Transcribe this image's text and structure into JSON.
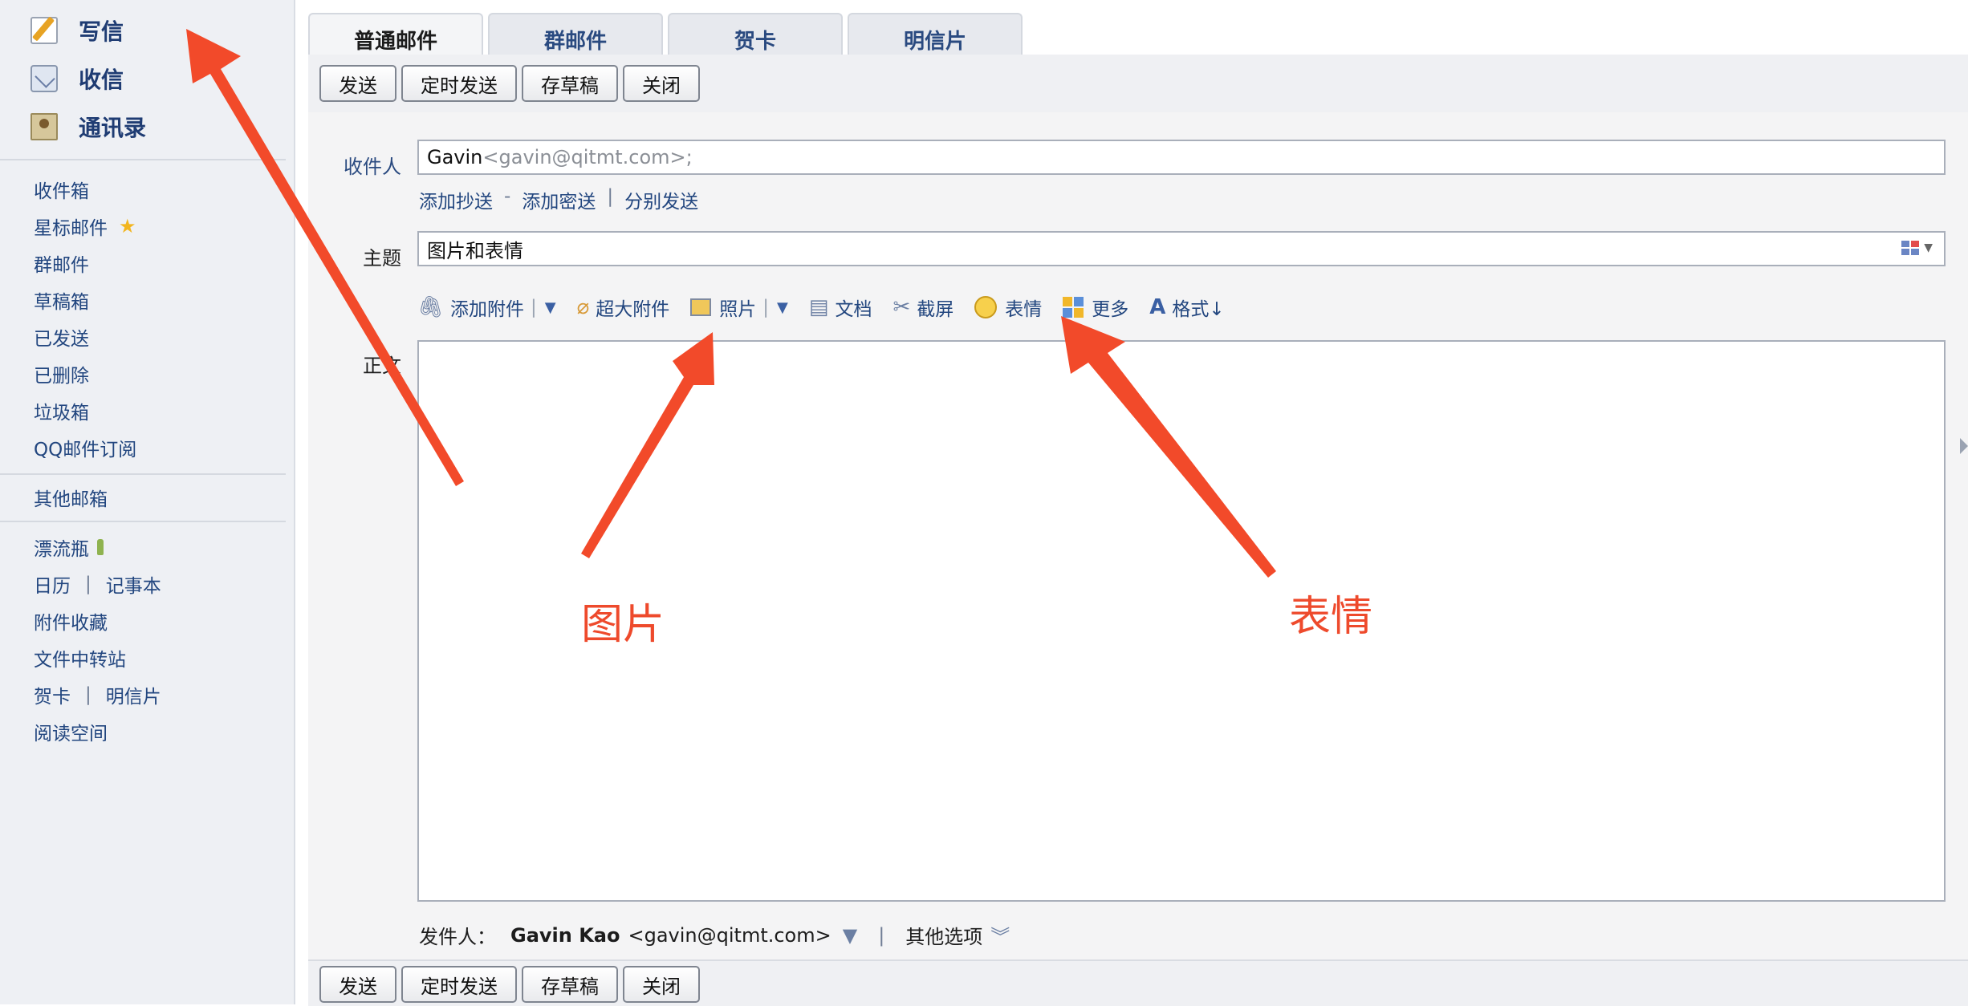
{
  "sidebar": {
    "top_items": [
      {
        "label": "写信",
        "icon": "pencil-paper-icon"
      },
      {
        "label": "收信",
        "icon": "inbox-tray-icon"
      },
      {
        "label": "通讯录",
        "icon": "contact-card-icon"
      }
    ],
    "folders": [
      "收件箱",
      "星标邮件",
      "群邮件",
      "草稿箱",
      "已发送",
      "已删除",
      "垃圾箱",
      "QQ邮件订阅"
    ],
    "other_mailbox": "其他邮箱",
    "apps": {
      "drift_bottle": "漂流瓶",
      "calendar": "日历",
      "notebook": "记事本",
      "attachments": "附件收藏",
      "file_transfer": "文件中转站",
      "greeting_card": "贺卡",
      "postcard": "明信片",
      "reading_space": "阅读空间"
    },
    "separator": "|"
  },
  "tabs": [
    "普通邮件",
    "群邮件",
    "贺卡",
    "明信片"
  ],
  "actions": {
    "send": "发送",
    "schedule": "定时发送",
    "draft": "存草稿",
    "close": "关闭"
  },
  "compose": {
    "to_label": "收件人",
    "to_name": "Gavin",
    "to_addr": "<gavin@qitmt.com>;",
    "add_cc": "添加抄送",
    "dash": "-",
    "add_bcc": "添加密送",
    "pipe": "|",
    "separate_send": "分别发送",
    "subject_label": "主题",
    "subject_value": "图片和表情",
    "body_label": "正文",
    "toolbar": {
      "attach": "添加附件",
      "big_attach": "超大附件",
      "photo": "照片",
      "document": "文档",
      "screenshot": "截屏",
      "emoji": "表情",
      "more": "更多",
      "format": "格式↓"
    },
    "sender_label": "发件人：",
    "sender_name": "Gavin Kao",
    "sender_addr": "<gavin@qitmt.com>",
    "sender_caret": "▼",
    "other_options": "其他选项"
  },
  "annotations": {
    "picture": "图片",
    "emoji": "表情",
    "color": "#ee4a2c"
  }
}
